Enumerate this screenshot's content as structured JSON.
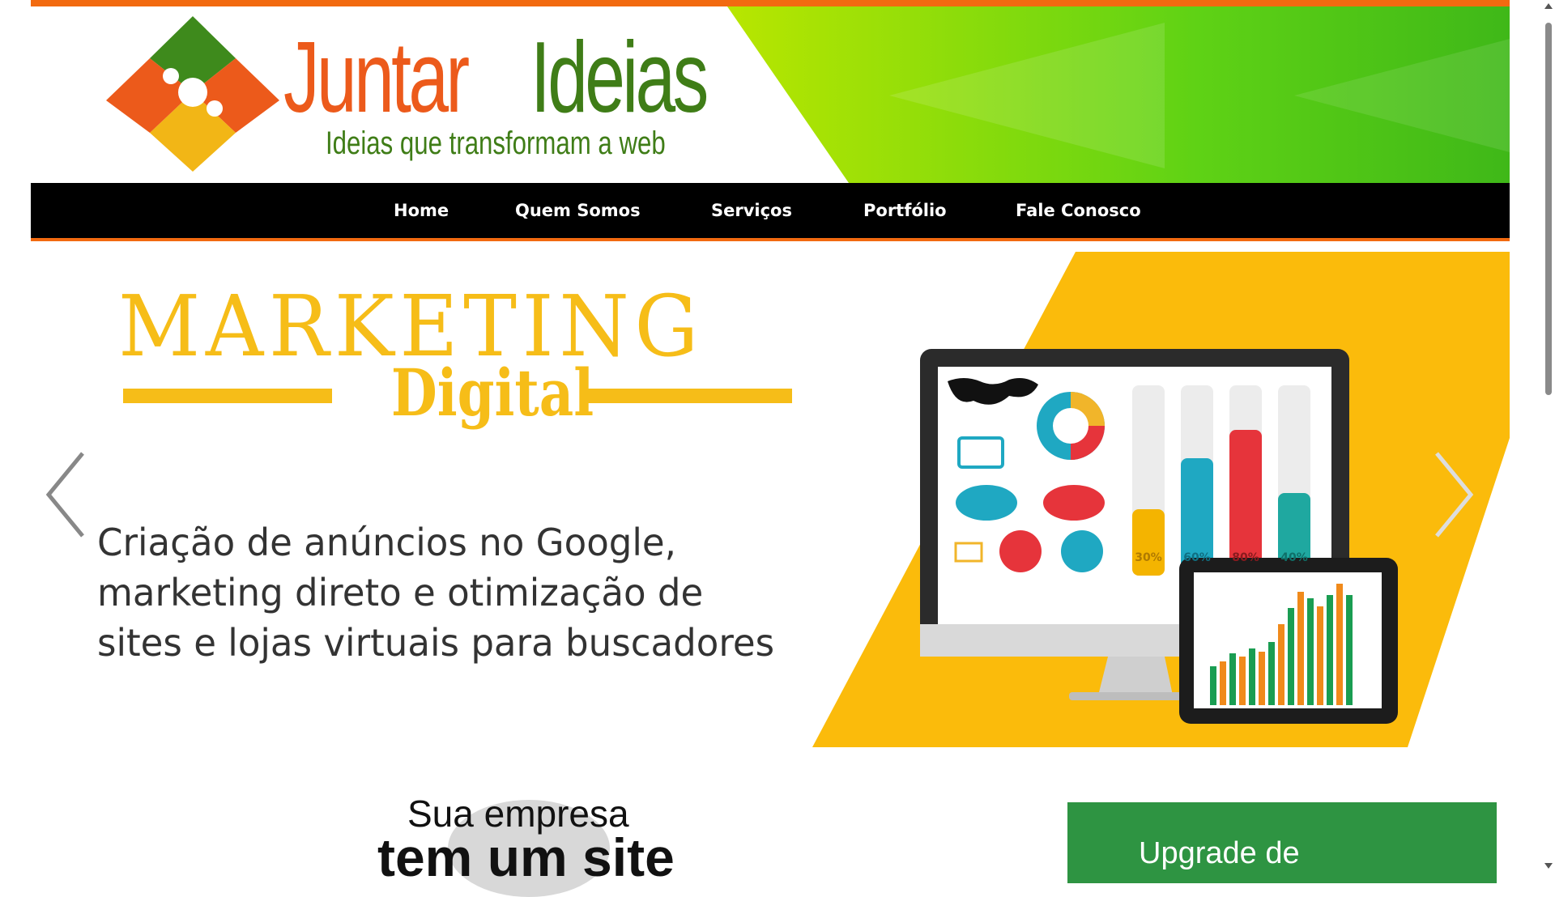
{
  "header": {
    "brand_word1": "Juntar",
    "brand_word2": "Ideias",
    "tagline": "Ideias que transformam a web",
    "logo_icon": "puzzle-logo"
  },
  "nav": {
    "items": [
      {
        "label": "Home"
      },
      {
        "label": "Quem Somos"
      },
      {
        "label": "Serviços"
      },
      {
        "label": "Portfólio"
      },
      {
        "label": "Fale Conosco"
      }
    ]
  },
  "slider": {
    "title": "MARKETING",
    "subtitle": "Digital",
    "description_lines": [
      "Criação de anúncios no Google,",
      "marketing direto e otimização de",
      "sites e lojas virtuais para buscadores"
    ],
    "gauge_labels": [
      "30%",
      "60%",
      "80%",
      "40%"
    ],
    "prev_icon": "chevron-left-icon",
    "next_icon": "chevron-right-icon"
  },
  "content": {
    "headline_small": "Sua empresa",
    "headline_large": "tem um site",
    "upgrade_label": "Upgrade de"
  },
  "colors": {
    "orange": "#f26a10",
    "green": "#3f7d17",
    "yellow": "#f6bd18",
    "nav_bg": "#000000",
    "upgrade_bg": "#2e9442"
  }
}
